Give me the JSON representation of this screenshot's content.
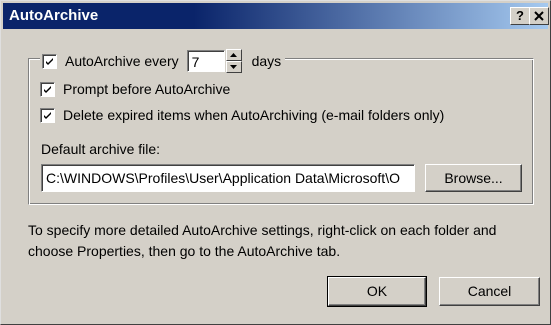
{
  "window": {
    "title": "AutoArchive",
    "help_label": "?",
    "close_label": "x"
  },
  "autoarchive": {
    "every_label": "AutoArchive every",
    "every_checked": true,
    "days_value": "7",
    "days_label": "days"
  },
  "options": {
    "prompt_label": "Prompt before AutoArchive",
    "prompt_checked": true,
    "delete_label": "Delete expired items when AutoArchiving (e-mail folders only)",
    "delete_checked": true
  },
  "archive_file": {
    "label": "Default archive file:",
    "path": "C:\\WINDOWS\\Profiles\\User\\Application Data\\Microsoft\\O",
    "browse_label": "Browse..."
  },
  "info_text": "To specify more detailed AutoArchive settings, right-click on each folder and choose Properties, then go to the AutoArchive tab.",
  "buttons": {
    "ok_label": "OK",
    "cancel_label": "Cancel"
  }
}
